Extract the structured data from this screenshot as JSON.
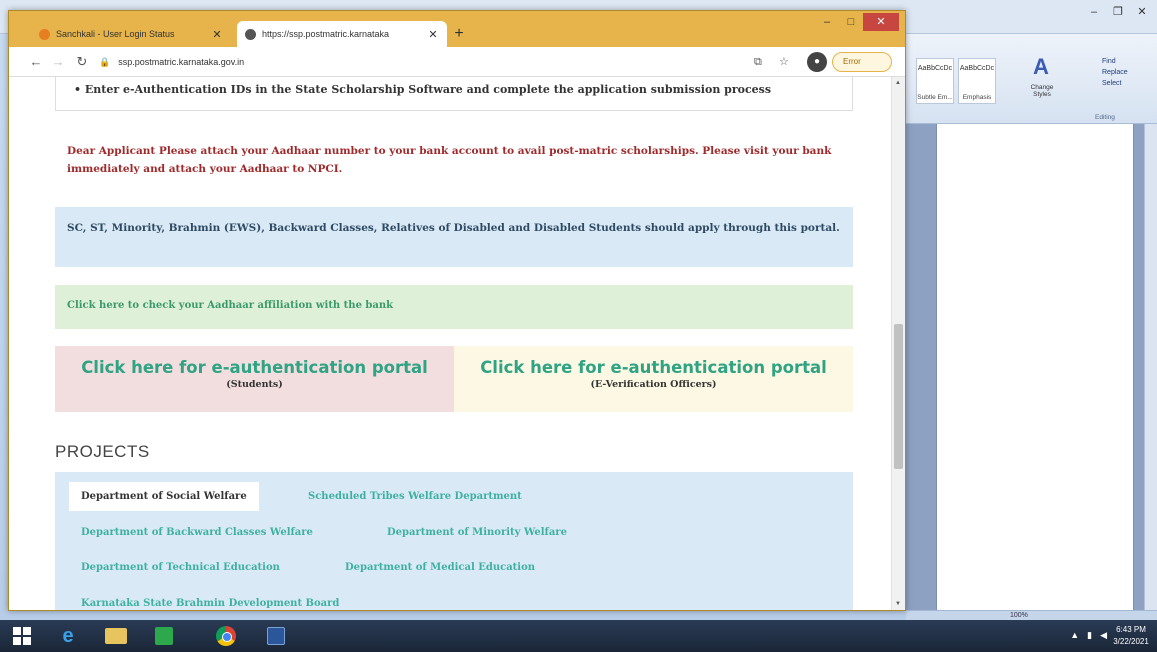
{
  "word": {
    "styles": [
      {
        "preview": "AaBbCcDc",
        "label": "Subtle Em..."
      },
      {
        "preview": "AaBbCcDc",
        "label": "Emphasis"
      }
    ],
    "change_styles": "Change Styles",
    "editing": {
      "find": "Find",
      "replace": "Replace",
      "select": "Select",
      "group_label": "Editing"
    },
    "zoom": "100%"
  },
  "browser": {
    "tabs": [
      {
        "title": "Sanchkali - User Login Status",
        "active": false
      },
      {
        "title": "https://ssp.postmatric.karnataka",
        "active": true
      }
    ],
    "url": "ssp.postmatric.karnataka.gov.in",
    "error_label": "Error"
  },
  "page": {
    "bullet": "Enter e-Authentication IDs in the State Scholarship Software and complete the application submission process",
    "notice_aadhaar": "Dear Applicant Please attach your Aadhaar number to your bank account to avail post-matric scholarships. Please visit your bank immediately and attach your Aadhaar to NPCI.",
    "notice_eligibility": "SC, ST, Minority, Brahmin (EWS), Backward Classes, Relatives of Disabled and Disabled Students should apply through this portal.",
    "check_aadhaar_link": "Click here to check your Aadhaar affiliation with the bank",
    "auth_students": {
      "title": "Click here for e-authentication portal",
      "sub": "(Students)"
    },
    "auth_officers": {
      "title": "Click here for e-authentication portal",
      "sub": "(E-Verification Officers)"
    },
    "projects_heading": "PROJECTS",
    "projects": [
      "Department of Social Welfare",
      "Scheduled Tribes Welfare Department",
      "Department of Backward Classes Welfare",
      "Department of Minority Welfare",
      "Department of Technical Education",
      "Department of Medical Education",
      "Karnataka State Brahmin Development Board"
    ]
  },
  "taskbar": {
    "time": "6:43 PM",
    "date": "3/22/2021"
  }
}
